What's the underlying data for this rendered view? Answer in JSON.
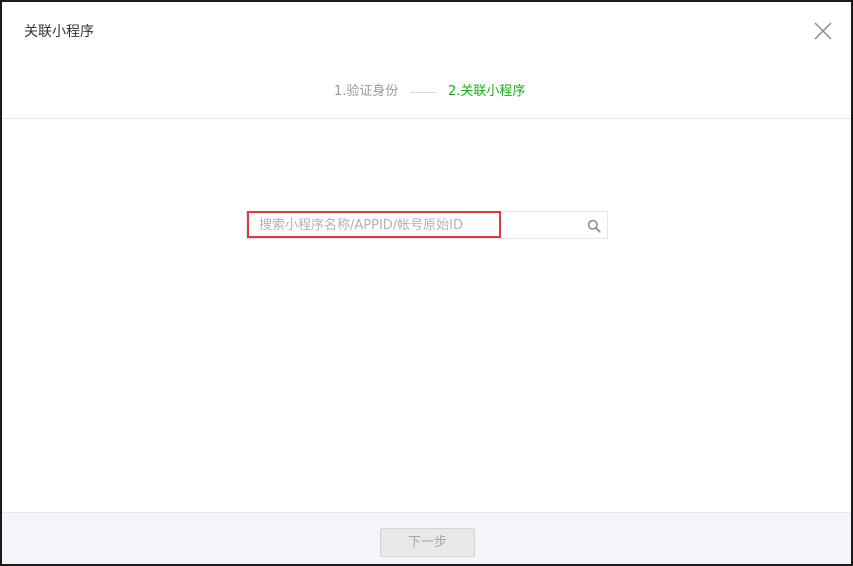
{
  "dialog": {
    "title": "关联小程序",
    "close_icon": "close-icon"
  },
  "steps": {
    "step1_label": "1.验证身份",
    "step2_label": "2.关联小程序",
    "active_step": 2,
    "active_color": "#1aad19",
    "inactive_color": "#9a9a9a"
  },
  "search": {
    "placeholder": "搜索小程序名称/APPID/帐号原始ID",
    "value": "",
    "icon": "search-icon"
  },
  "highlight": {
    "color": "#e0393e"
  },
  "footer": {
    "next_label": "下一步",
    "next_disabled": true
  }
}
